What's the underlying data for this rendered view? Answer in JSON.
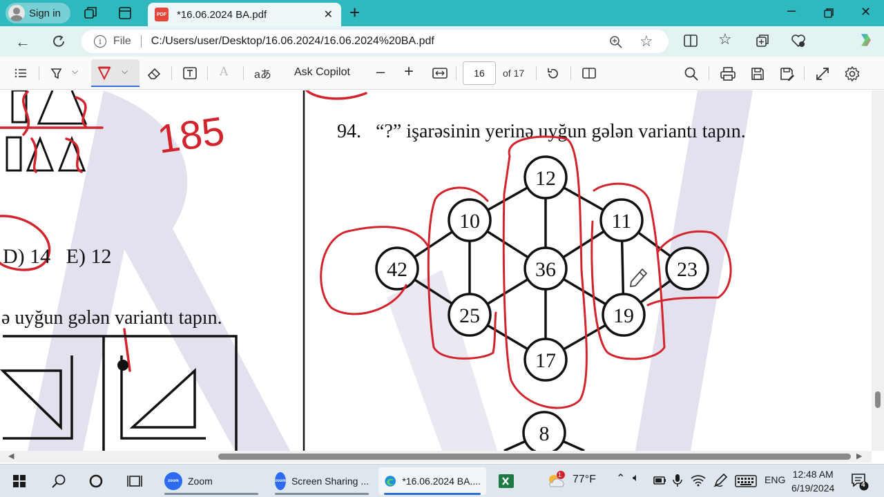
{
  "browser": {
    "sign_in_label": "Sign in",
    "tab_title": "*16.06.2024 BA.pdf",
    "address_file_label": "File",
    "url": "C:/Users/user/Desktop/16.06.2024/16.06.2024%20BA.pdf"
  },
  "pdf_toolbar": {
    "ask_copilot_label": "Ask Copilot",
    "current_page": "16",
    "page_count_label": "of 17",
    "translate_glyph": "aあ"
  },
  "document": {
    "left_answers": "D) 14   E) 12",
    "left_question_fragment": "ə uyğun gələn variantı tapın.",
    "handwritten_number": "185",
    "question_number": "94.",
    "question_text": "“?” işarəsinin yerinə uyğun gələn variantı tapın.",
    "nodes": {
      "top": "12",
      "upper_left": "10",
      "upper_right": "11",
      "left": "42",
      "center": "36",
      "right": "23",
      "lower_left": "25",
      "lower_right": "19",
      "bottom": "17",
      "next": "8"
    }
  },
  "taskbar": {
    "zoom_label": "Zoom",
    "screen_sharing_label": "Screen Sharing ...",
    "edge_label": "*16.06.2024 BA....",
    "weather_temp": "77°F",
    "weather_badge": "1",
    "language": "ENG",
    "time": "12:48 AM",
    "date": "6/19/2024",
    "notification_count": "4"
  },
  "colors": {
    "titlebar": "#2fb8be",
    "addressbar": "#e3f3f3",
    "ink_red": "#d2242c",
    "watermark": "#e4e1ee"
  }
}
